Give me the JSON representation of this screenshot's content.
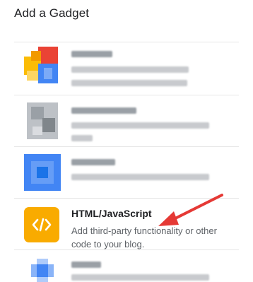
{
  "dialog": {
    "title": "Add a Gadget"
  },
  "gadgets": [
    {
      "name": "",
      "description": "",
      "icon": "blurred-multicolor-icon"
    },
    {
      "name": "",
      "description": "",
      "icon": "blurred-gray-icon"
    },
    {
      "name": "",
      "description": "",
      "icon": "blurred-blue-icon"
    },
    {
      "name": "HTML/JavaScript",
      "description": "Add third-party functionality or other code to your blog.",
      "icon": "code-icon",
      "icon_color": "#f9ab00"
    },
    {
      "name": "",
      "description": "",
      "icon": "blurred-blue-dot-icon"
    }
  ],
  "annotation": {
    "arrow_color": "#e53935"
  }
}
